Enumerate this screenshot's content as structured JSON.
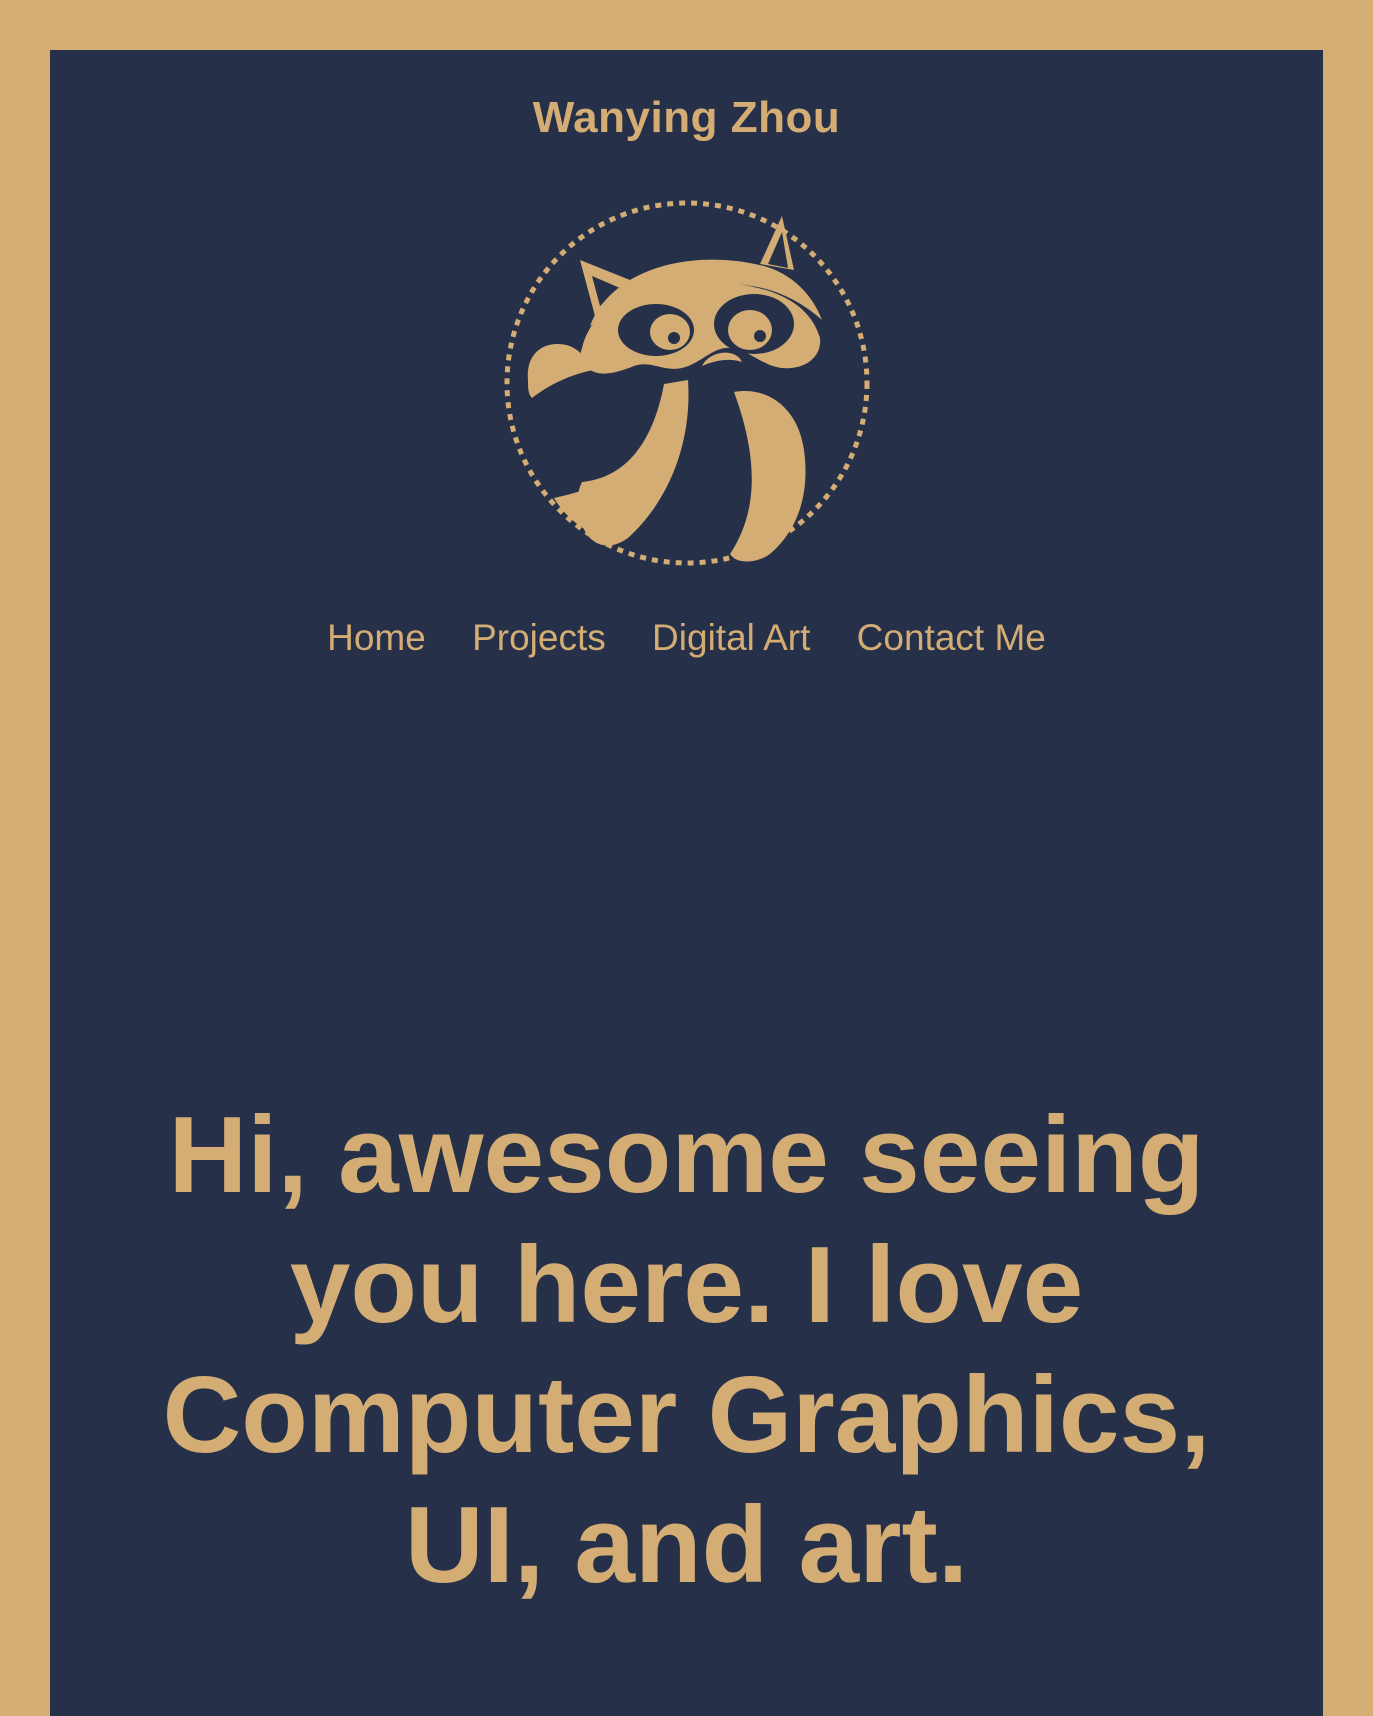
{
  "header": {
    "site_title": "Wanying Zhou",
    "logo_icon": "raccoon-logo-icon"
  },
  "nav": {
    "items": [
      {
        "label": "Home"
      },
      {
        "label": "Projects"
      },
      {
        "label": "Digital Art"
      },
      {
        "label": "Contact Me"
      }
    ]
  },
  "hero": {
    "heading": "Hi, awesome seeing you here. I love Computer Graphics, UI, and art."
  },
  "colors": {
    "background": "#d3ad74",
    "panel": "#263049",
    "accent": "#d3ad74"
  }
}
